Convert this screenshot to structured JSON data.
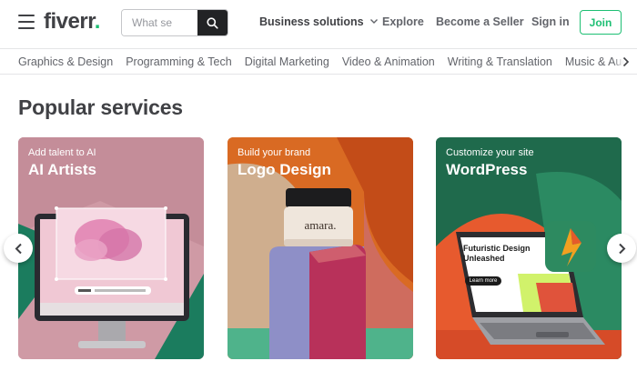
{
  "header": {
    "logo_text": "fiverr",
    "logo_dot": ".",
    "search_placeholder": "What se",
    "nav": {
      "business": "Business solutions",
      "explore": "Explore",
      "become_seller": "Become a Seller",
      "sign_in": "Sign in",
      "join": "Join"
    }
  },
  "categories": [
    "Graphics & Design",
    "Programming & Tech",
    "Digital Marketing",
    "Video & Animation",
    "Writing & Translation",
    "Music & Audio"
  ],
  "section": {
    "title": "Popular services",
    "cards": [
      {
        "subtitle": "Add talent to AI",
        "title": "AI Artists"
      },
      {
        "subtitle": "Build your brand",
        "title": "Logo Design",
        "jar_label": "amara."
      },
      {
        "subtitle": "Customize your site",
        "title": "WordPress",
        "screen_headline": "Futuristic Design Unleashed",
        "screen_button": "Learn more"
      }
    ]
  },
  "colors": {
    "brand_green": "#1dbf73",
    "text_dark": "#404145",
    "text_muted": "#62646a"
  },
  "icons": {
    "menu": "hamburger-icon",
    "search": "search-icon",
    "business_chevron": "chevron-down-icon",
    "category_next": "chevron-right-icon",
    "carousel_prev": "chevron-left-icon",
    "carousel_next": "chevron-right-icon"
  }
}
